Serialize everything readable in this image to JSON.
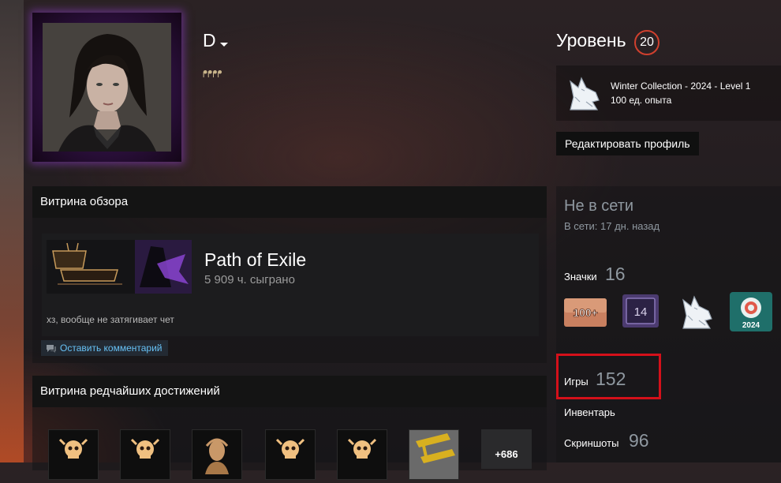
{
  "profile": {
    "persona_name": "D",
    "tag_glyphs": "ᖰᖰᖰᖰ",
    "level_label": "Уровень",
    "level_value": "20",
    "edit_profile_label": "Редактировать профиль"
  },
  "favorite_badge": {
    "icon": "winter-wolf-badge-icon",
    "title": "Winter Collection - 2024 - Level 1",
    "xp": "100 ед. опыта"
  },
  "review_showcase": {
    "title": "Витрина обзора",
    "game_name": "Path of Exile",
    "hours": "5 909 ч. сыграно",
    "review_text": "хз, вообще не затягивает чет",
    "comment_label": "Оставить комментарий"
  },
  "achievement_showcase": {
    "title": "Витрина редчайших достижений",
    "more_label": "+686"
  },
  "sidebar": {
    "status": "Не в сети",
    "last_online": "В сети: 17 дн. назад",
    "badges_label": "Значки",
    "badges_count": "16",
    "badge_icons": [
      "years-100-badge-icon",
      "level-14-badge-icon",
      "winter-wolf-badge-icon",
      "steam-2024-badge-icon"
    ],
    "badge_14_text": "14",
    "badge_2024_text": "2024",
    "games_label": "Игры",
    "games_count": "152",
    "inventory_label": "Инвентарь",
    "screenshots_label": "Скриншоты",
    "screenshots_count": "96"
  },
  "colors": {
    "level_ring": "#d0402e",
    "link_blue": "#67c1f5",
    "highlight_red": "#d4101a",
    "muted_text": "#8f98a0"
  }
}
